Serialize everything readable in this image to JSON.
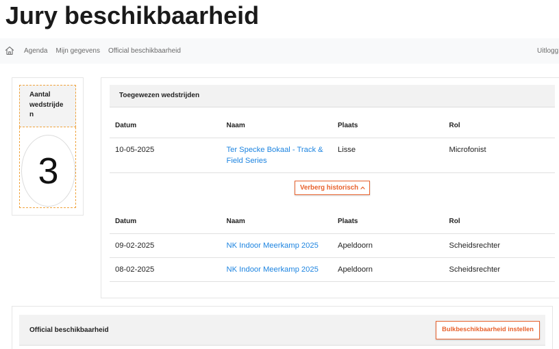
{
  "page": {
    "title": "Jury beschikbaarheid"
  },
  "nav": {
    "home_icon": "home-icon",
    "items": [
      {
        "label": "Agenda"
      },
      {
        "label": "Mijn gegevens"
      },
      {
        "label": "Official beschikbaarheid"
      }
    ],
    "logout_label": "Uitlogg"
  },
  "stats": {
    "label": "Aantal wedstrijden",
    "value": 3
  },
  "assigned": {
    "title": "Toegewezen wedstrijden",
    "columns": [
      "Datum",
      "Naam",
      "Plaats",
      "Rol"
    ],
    "upcoming": [
      {
        "datum": "10-05-2025",
        "naam": "Ter Specke Bokaal - Track & Field Series",
        "plaats": "Lisse",
        "rol": "Microfonist"
      }
    ],
    "toggle_history_label": "Verberg historisch",
    "toggle_history_icon": "chevron-up-icon",
    "history": [
      {
        "datum": "09-02-2025",
        "naam": "NK Indoor Meerkamp 2025",
        "plaats": "Apeldoorn",
        "rol": "Scheidsrechter"
      },
      {
        "datum": "08-02-2025",
        "naam": "NK Indoor Meerkamp 2025",
        "plaats": "Apeldoorn",
        "rol": "Scheidsrechter"
      }
    ]
  },
  "availability": {
    "title": "Official beschikbaarheid",
    "bulk_button_label": "Bulkbeschikbaarheid instellen"
  },
  "colors": {
    "accent": "#e8612c",
    "link": "#1d84e0",
    "dashed_outline": "#f0a23a",
    "nav_background": "#f8f9fa",
    "header_background": "#f2f2f2"
  }
}
